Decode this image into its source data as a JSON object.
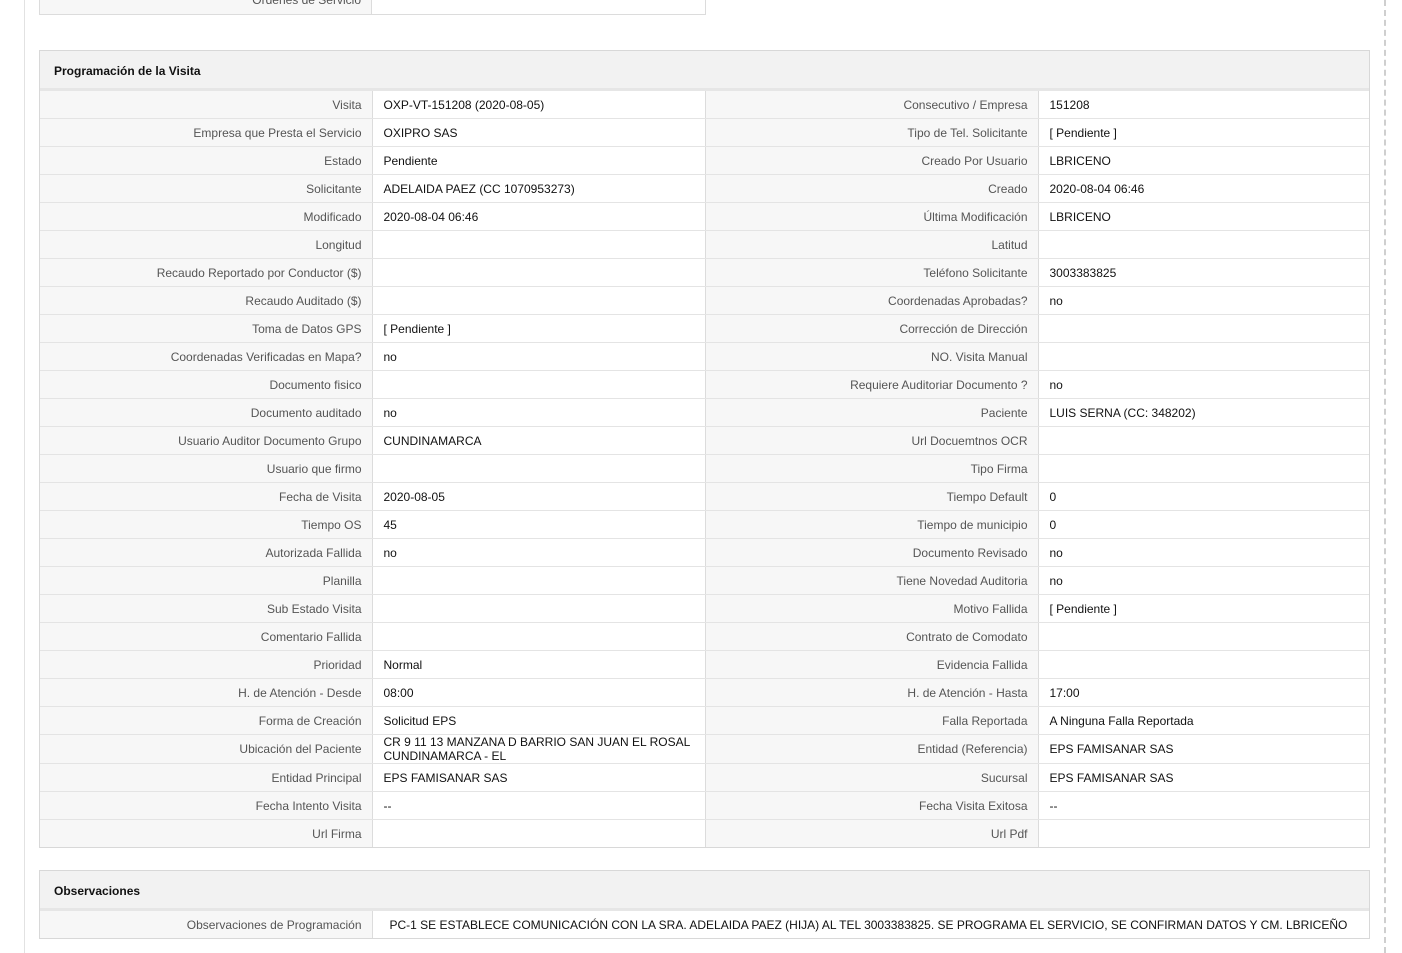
{
  "top_fragment": {
    "label": "Órdenes de Servicio",
    "value": ""
  },
  "programacion": {
    "title": "Programación de la Visita",
    "rows": [
      [
        {
          "label": "Visita",
          "value": "OXP-VT-151208 (2020-08-05)"
        },
        {
          "label": "Consecutivo / Empresa",
          "value": "151208"
        }
      ],
      [
        {
          "label": "Empresa que Presta el Servicio",
          "value": "OXIPRO SAS"
        },
        {
          "label": "Tipo de Tel. Solicitante",
          "value": "[ Pendiente ]"
        }
      ],
      [
        {
          "label": "Estado",
          "value": "Pendiente"
        },
        {
          "label": "Creado Por Usuario",
          "value": "LBRICENO"
        }
      ],
      [
        {
          "label": "Solicitante",
          "value": "ADELAIDA PAEZ (CC 1070953273)"
        },
        {
          "label": "Creado",
          "value": "2020-08-04 06:46"
        }
      ],
      [
        {
          "label": "Modificado",
          "value": "2020-08-04 06:46"
        },
        {
          "label": "Última Modificación",
          "value": " LBRICENO"
        }
      ],
      [
        {
          "label": "Longitud",
          "value": ""
        },
        {
          "label": "Latitud",
          "value": ""
        }
      ],
      [
        {
          "label": "Recaudo Reportado por Conductor ($)",
          "value": ""
        },
        {
          "label": "Teléfono Solicitante",
          "value": "3003383825"
        }
      ],
      [
        {
          "label": "Recaudo Auditado ($)",
          "value": ""
        },
        {
          "label": "Coordenadas Aprobadas?",
          "value": " no"
        }
      ],
      [
        {
          "label": "Toma de Datos GPS",
          "value": "[ Pendiente ]"
        },
        {
          "label": "Corrección de Dirección",
          "value": ""
        }
      ],
      [
        {
          "label": "Coordenadas Verificadas en Mapa?",
          "value": " no"
        },
        {
          "label": "NO. Visita Manual",
          "value": ""
        }
      ],
      [
        {
          "label": "Documento fisico",
          "value": ""
        },
        {
          "label": "Requiere Auditoriar Documento ?",
          "value": " no"
        }
      ],
      [
        {
          "label": "Documento auditado",
          "value": " no"
        },
        {
          "label": "Paciente",
          "value": "LUIS SERNA (CC: 348202)"
        }
      ],
      [
        {
          "label": "Usuario Auditor Documento Grupo",
          "value": "CUNDINAMARCA"
        },
        {
          "label": "Url Docuemtnos OCR",
          "value": ""
        }
      ],
      [
        {
          "label": "Usuario que firmo",
          "value": ""
        },
        {
          "label": "Tipo Firma",
          "value": ""
        }
      ],
      [
        {
          "label": "Fecha de Visita",
          "value": " 2020-08-05"
        },
        {
          "label": "Tiempo Default",
          "value": "0"
        }
      ],
      [
        {
          "label": "Tiempo OS",
          "value": "45"
        },
        {
          "label": "Tiempo de municipio",
          "value": "0"
        }
      ],
      [
        {
          "label": "Autorizada Fallida",
          "value": " no"
        },
        {
          "label": "Documento Revisado",
          "value": " no"
        }
      ],
      [
        {
          "label": "Planilla",
          "value": ""
        },
        {
          "label": "Tiene Novedad Auditoria",
          "value": " no"
        }
      ],
      [
        {
          "label": "Sub Estado Visita",
          "value": ""
        },
        {
          "label": "Motivo Fallida",
          "value": "[ Pendiente ]"
        }
      ],
      [
        {
          "label": "Comentario Fallida",
          "value": ""
        },
        {
          "label": "Contrato de Comodato",
          "value": ""
        }
      ],
      [
        {
          "label": "Prioridad",
          "value": "Normal"
        },
        {
          "label": "Evidencia Fallida",
          "value": ""
        }
      ],
      [
        {
          "label": "H. de Atención - Desde",
          "value": "08:00"
        },
        {
          "label": "H. de Atención - Hasta",
          "value": "17:00"
        }
      ],
      [
        {
          "label": "Forma de Creación",
          "value": "Solicitud EPS"
        },
        {
          "label": "Falla Reportada",
          "value": "A Ninguna Falla Reportada"
        }
      ],
      [
        {
          "label": "Ubicación del Paciente",
          "value": "CR 9 11 13 MANZANA D BARRIO SAN JUAN EL ROSAL CUNDINAMARCA - EL"
        },
        {
          "label": "Entidad (Referencia)",
          "value": "EPS FAMISANAR SAS"
        }
      ],
      [
        {
          "label": "Entidad Principal",
          "value": "EPS FAMISANAR SAS"
        },
        {
          "label": "Sucursal",
          "value": "EPS FAMISANAR SAS"
        }
      ],
      [
        {
          "label": "Fecha Intento Visita",
          "value": "--"
        },
        {
          "label": "Fecha Visita Exitosa",
          "value": " --"
        }
      ],
      [
        {
          "label": "Url Firma",
          "value": ""
        },
        {
          "label": "Url Pdf",
          "value": ""
        }
      ]
    ]
  },
  "observaciones": {
    "title": "Observaciones",
    "label": "Observaciones de Programación",
    "value": "PC-1 SE ESTABLECE COMUNICACIÓN CON LA SRA. ADELAIDA PAEZ (HIJA) AL TEL 3003383825. SE PROGRAMA EL SERVICIO, SE CONFIRMAN DATOS Y CM. LBRICEÑO"
  }
}
